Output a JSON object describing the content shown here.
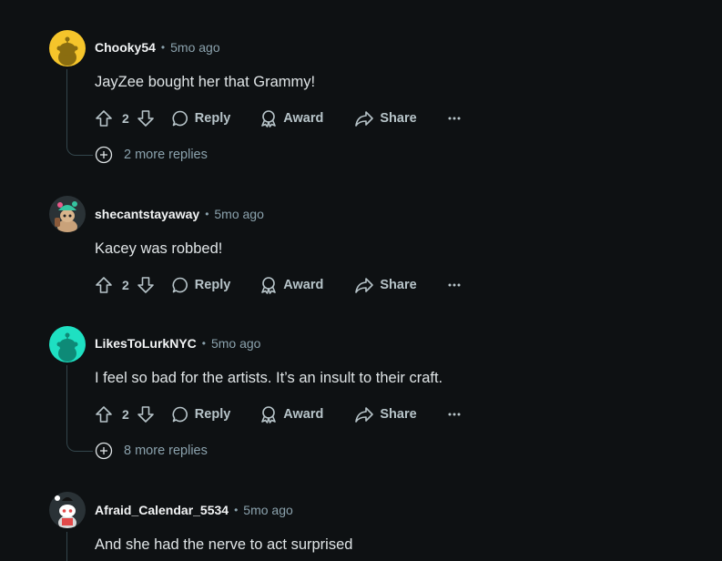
{
  "comments": [
    {
      "author": "Chooky54",
      "separator": "•",
      "time": "5mo ago",
      "text": "JayZee bought her that Grammy!",
      "votes": "2",
      "reply_label": "Reply",
      "award_label": "Award",
      "share_label": "Share",
      "more_replies": "2 more replies",
      "avatar_color": "#f5c52b"
    },
    {
      "author": "shecantstayaway",
      "separator": "•",
      "time": "5mo ago",
      "text": "Kacey was robbed!",
      "votes": "2",
      "reply_label": "Reply",
      "award_label": "Award",
      "share_label": "Share",
      "avatar_color": "#2a3236"
    },
    {
      "author": "LikesToLurkNYC",
      "separator": "•",
      "time": "5mo ago",
      "text": "I feel so bad for the artists. It’s an insult to their craft.",
      "votes": "2",
      "reply_label": "Reply",
      "award_label": "Award",
      "share_label": "Share",
      "more_replies": "8 more replies",
      "avatar_color": "#1ee0c2"
    },
    {
      "author": "Afraid_Calendar_5534",
      "separator": "•",
      "time": "5mo ago",
      "text": "And she had the nerve to act surprised",
      "avatar_color": "#2a3236"
    }
  ],
  "icons": {
    "upvote": "upvote-icon",
    "downvote": "downvote-icon",
    "reply": "comment-bubble-icon",
    "award": "award-icon",
    "share": "share-arrow-icon",
    "more": "ellipsis-icon",
    "expand": "plus-circle-icon"
  },
  "colors": {
    "background": "#0e1113",
    "author": "#f2f4f5",
    "meta": "#8ba2ad",
    "body": "#dfe4e6",
    "thread_line": "#33464c"
  }
}
